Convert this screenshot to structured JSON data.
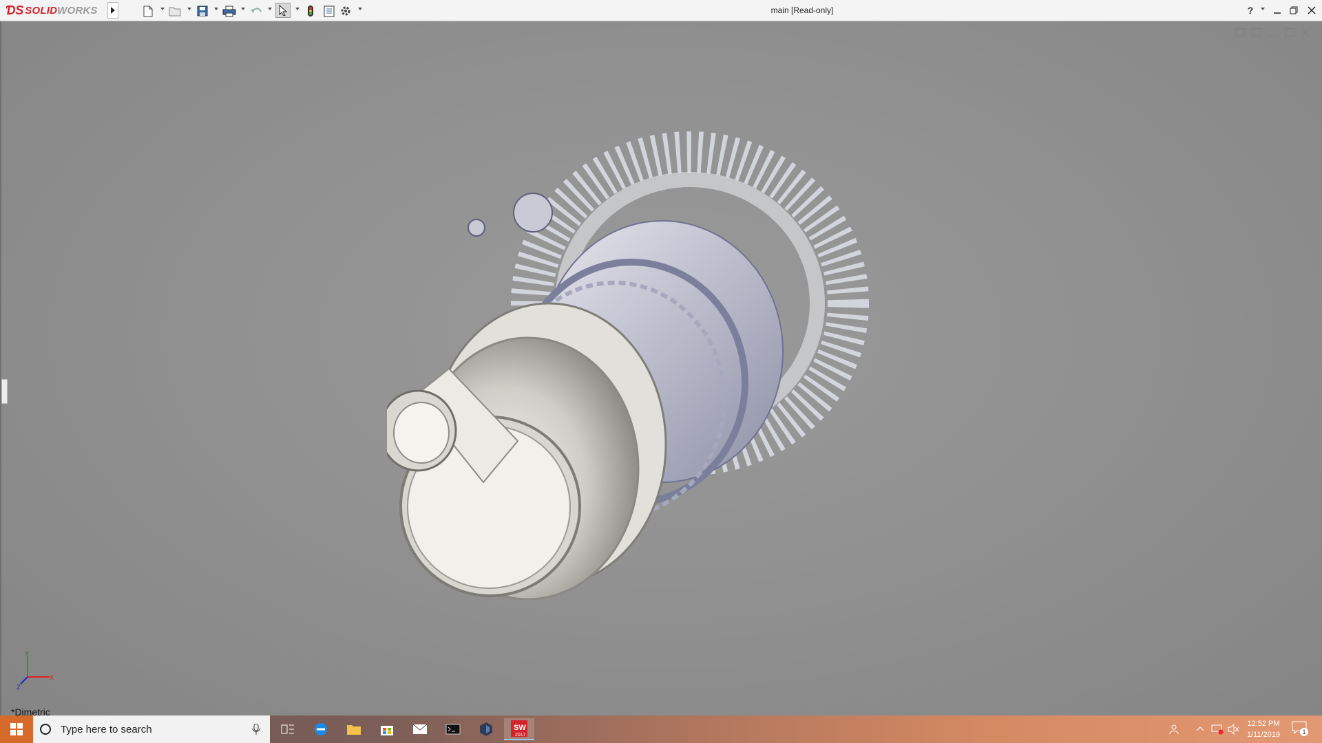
{
  "app": {
    "brand_ds": "ƊS",
    "brand_solid": "SOLID",
    "brand_works": "WORKS",
    "document_title": "main [Read-only]",
    "help_label": "?"
  },
  "toolbar": {
    "icons": [
      "new-document-icon",
      "open-icon",
      "save-icon",
      "print-icon",
      "undo-icon",
      "select-icon",
      "rebuild-icon",
      "file-properties-icon",
      "options-icon"
    ]
  },
  "viewport": {
    "view_orientation": "*Dimetric",
    "triad": {
      "x": "X",
      "y": "Y",
      "z": "Z"
    }
  },
  "taskbar": {
    "search_placeholder": "Type here to search",
    "apps": [
      "task-view-icon",
      "edge-icon",
      "file-explorer-icon",
      "store-icon",
      "mail-icon",
      "terminal-icon",
      "app-icon",
      "solidworks-icon"
    ],
    "solidworks_badge": "SW",
    "solidworks_year": "2017",
    "time": "12:52 PM",
    "date": "1/11/2019",
    "notification_count": "1"
  },
  "colors": {
    "brand_red": "#d5222a",
    "viewport_bg": "#8f8f8f",
    "start_orange": "#d56a2b"
  }
}
